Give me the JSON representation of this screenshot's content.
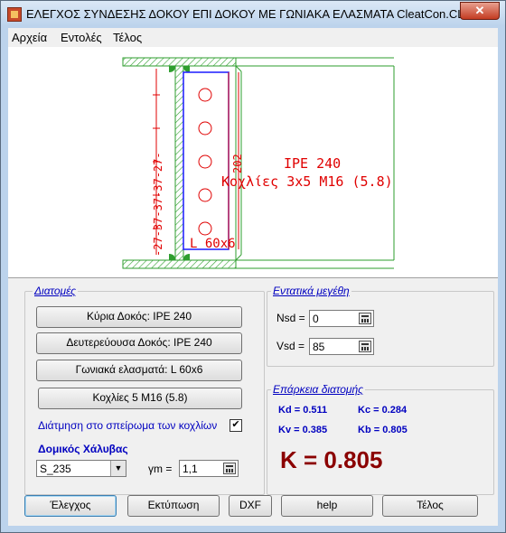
{
  "window": {
    "title": "ΕΛΕΓΧΟΣ ΣΥΝΔΕΣΗΣ ΔΟΚΟΥ ΕΠΙ ΔΟΚΟΥ ΜΕ ΓΩΝΙΑΚΑ ΕΛΑΣΜΑΤΑ  CleatCon.CLT",
    "close_glyph": "✕"
  },
  "menu": {
    "items": [
      "Αρχεία",
      "Εντολές",
      "Τέλος"
    ]
  },
  "drawing": {
    "dims_text": "-27-37-37-37-27-",
    "height_dim": "202",
    "beam_label": "IPE 240",
    "bolts_label": "Κοχλίες 3x5 M16 (5.8)",
    "angle_label": "L 60x6",
    "colors": {
      "steel": "#2e9e2e",
      "cleat": "#1a1aff",
      "bolts": "#e00000"
    }
  },
  "sections": {
    "title": "Διατομές",
    "main_beam": "Κύρια Δοκός: IPE 240",
    "secondary_beam": "Δευτερεύουσα Δοκός: IPE 240",
    "angles": "Γωνιακά ελασματά:  L 60x6",
    "bolts": "Κοχλίες 5 M16 (5.8)",
    "thread_label": "Διάτμηση στο σπείρωμα των κοχλίων",
    "thread_checked": "✔",
    "steel_title": "Δομικός Χάλυβας",
    "steel_value": "S_235",
    "gamma_label": "γm =",
    "gamma_value": "1,1"
  },
  "forces": {
    "title": "Εντατικά μεγέθη",
    "nsd_label": "Nsd =",
    "nsd_value": "0",
    "vsd_label": "Vsd =",
    "vsd_value": "85"
  },
  "adequacy": {
    "title": "Επάρκεια διατομής",
    "kd": "Kd = 0.511",
    "kc": "Kc = 0.284",
    "kv": "Kv = 0.385",
    "kb": "Kb = 0.805",
    "k_total": "K = 0.805"
  },
  "buttons": {
    "check": "Έλεγχος",
    "print": "Εκτύπωση",
    "dxf": "DXF",
    "help": "help",
    "end": "Τέλος"
  }
}
